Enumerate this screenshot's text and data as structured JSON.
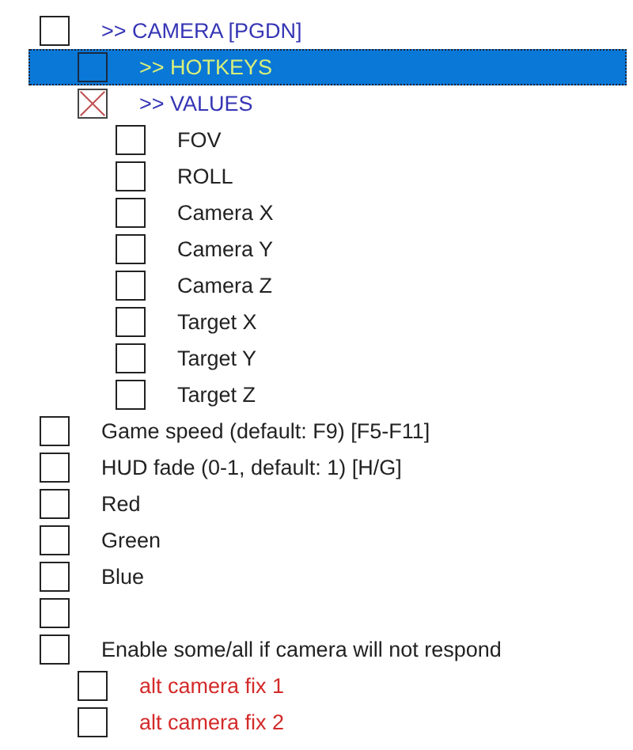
{
  "tree": [
    {
      "kind": "header",
      "label": ">> CAMERA [PGDN]",
      "checked": false,
      "selected": false,
      "children": [
        {
          "kind": "header",
          "label": ">> HOTKEYS",
          "checked": false,
          "selected": true
        },
        {
          "kind": "header",
          "label": ">> VALUES",
          "checked": true,
          "selected": false,
          "children": [
            {
              "kind": "option",
              "label": "FOV",
              "checked": false,
              "selected": false
            },
            {
              "kind": "option",
              "label": "ROLL",
              "checked": false,
              "selected": false
            },
            {
              "kind": "option",
              "label": "Camera X",
              "checked": false,
              "selected": false
            },
            {
              "kind": "option",
              "label": "Camera Y",
              "checked": false,
              "selected": false
            },
            {
              "kind": "option",
              "label": "Camera Z",
              "checked": false,
              "selected": false
            },
            {
              "kind": "option",
              "label": "Target X",
              "checked": false,
              "selected": false
            },
            {
              "kind": "option",
              "label": "Target Y",
              "checked": false,
              "selected": false
            },
            {
              "kind": "option",
              "label": "Target Z",
              "checked": false,
              "selected": false
            }
          ]
        }
      ]
    },
    {
      "kind": "option",
      "label": "Game speed (default: F9) [F5-F11]",
      "checked": false,
      "selected": false
    },
    {
      "kind": "option",
      "label": "HUD fade (0-1, default: 1) [H/G]",
      "checked": false,
      "selected": false
    },
    {
      "kind": "option",
      "label": "Red",
      "checked": false,
      "selected": false
    },
    {
      "kind": "option",
      "label": "Green",
      "checked": false,
      "selected": false
    },
    {
      "kind": "option",
      "label": "Blue",
      "checked": false,
      "selected": false
    },
    {
      "kind": "option",
      "checked": false,
      "selected": false
    },
    {
      "kind": "option",
      "label": "Enable some/all if camera will not respond",
      "checked": false,
      "selected": false,
      "children": [
        {
          "kind": "alt",
          "label": "alt camera fix 1",
          "checked": false,
          "selected": false
        },
        {
          "kind": "alt",
          "label": "alt camera fix 2",
          "checked": false,
          "selected": false
        }
      ]
    }
  ]
}
